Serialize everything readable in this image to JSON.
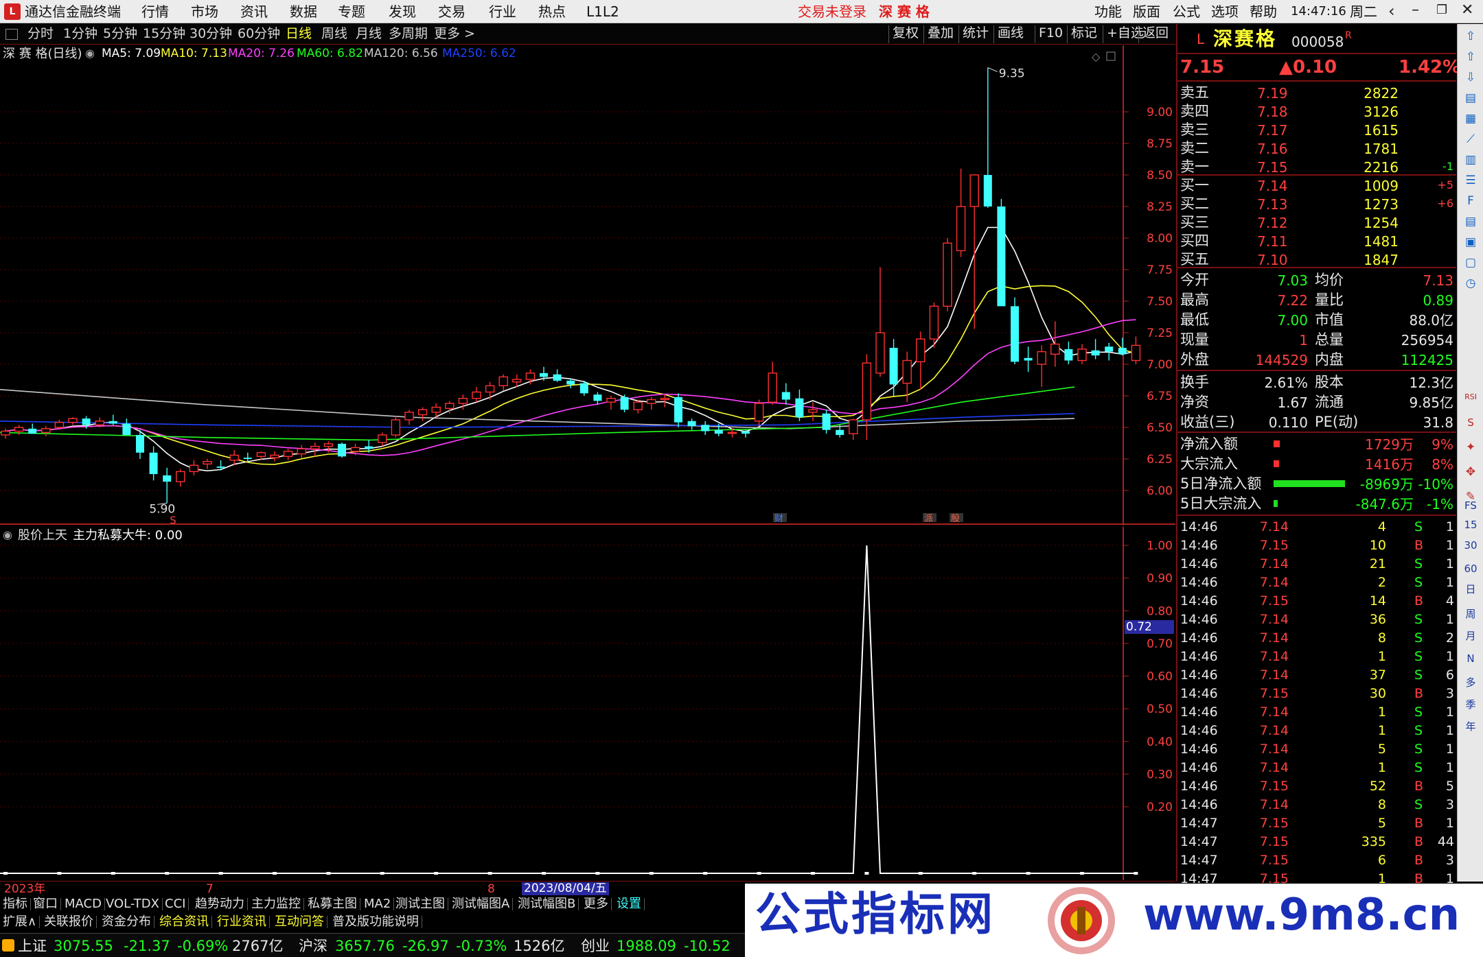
{
  "titlebar": {
    "app_title": "通达信金融终端",
    "menus": [
      "行情",
      "市场",
      "资讯",
      "数据",
      "专题",
      "发现",
      "交易",
      "行业",
      "热点",
      "L1L2"
    ],
    "login_status": "交易未登录",
    "stock_name_center": "深 赛 格",
    "right_menus": [
      "功能",
      "版面",
      "公式",
      "选项",
      "帮助"
    ],
    "clock": "14:47:16",
    "weekday": "周二"
  },
  "period_toolbar": {
    "tabs": [
      "分时",
      "1分钟",
      "5分钟",
      "15分钟",
      "30分钟",
      "60分钟",
      "日线",
      "周线",
      "月线",
      "多周期",
      "更多 >"
    ],
    "active": "日线",
    "right_tools": [
      "复权",
      "叠加",
      "统计",
      "画线",
      "F10",
      "标记",
      "+自选",
      "返回"
    ]
  },
  "main_chart": {
    "legend_title": "深 赛 格(日线)",
    "ma": [
      {
        "label": "MA5: 7.09",
        "color": "#ffffff"
      },
      {
        "label": "MA10: 7.13",
        "color": "#ffff33"
      },
      {
        "label": "MA20: 7.26",
        "color": "#ff40ff"
      },
      {
        "label": "MA60: 6.82",
        "color": "#20ff20"
      },
      {
        "label": "MA120: 6.56",
        "color": "#c8c8c8"
      },
      {
        "label": "MA250: 6.62",
        "color": "#2040ff"
      }
    ],
    "high_marker": "9.35",
    "low_marker": "5.90",
    "price_ticks": [
      "9.00",
      "8.75",
      "8.50",
      "8.25",
      "8.00",
      "7.75",
      "7.50",
      "7.25",
      "7.00",
      "6.75",
      "6.50",
      "6.25",
      "6.00"
    ],
    "event_labels": [
      "财",
      "派",
      "股"
    ],
    "low_mark_label": "S"
  },
  "indicator": {
    "title": "股价上天",
    "label": "主力私募大牛: 0.00",
    "ticks": [
      "1.00",
      "0.90",
      "0.80",
      "0.70",
      "0.60",
      "0.50",
      "0.40",
      "0.30",
      "0.20"
    ],
    "cursor_value": "0.72"
  },
  "datebar": {
    "year": "2023年",
    "m1": "7",
    "m2": "8",
    "highlight": "2023/08/04/五"
  },
  "tabs_row1": [
    "指标",
    "窗口",
    "MACD",
    "VOL-TDX",
    "CCI",
    "趋势动力",
    "主力监控",
    "私募主图",
    "MA2",
    "测试主图",
    "测试幅图A",
    "测试幅图B",
    "更多",
    "设置"
  ],
  "tabs_row2": [
    "扩展∧",
    "关联报价",
    "资金分布",
    "综合资讯",
    "行业资讯",
    "互动问答",
    "普及版功能说明"
  ],
  "statusbar": {
    "idx1_name": "上证",
    "idx1_val": "3075.55",
    "idx1_chg": "-21.37",
    "idx1_pct": "-0.69%",
    "idx1_amt": "2767亿",
    "idx2_name": "沪深",
    "idx2_val": "3657.76",
    "idx2_chg": "-26.97",
    "idx2_pct": "-0.73%",
    "idx2_amt": "1526亿",
    "idx3_name": "创业",
    "idx3_val": "1988.09",
    "idx3_chg": "-10.52"
  },
  "quote": {
    "l_badge": "L",
    "name": "深赛格",
    "code": "000058",
    "r_badge": "R",
    "price": "7.15",
    "change": "▲0.10",
    "pct": "1.42%",
    "asks": [
      {
        "label": "卖五",
        "price": "7.19",
        "vol": "2822",
        "delta": ""
      },
      {
        "label": "卖四",
        "price": "7.18",
        "vol": "3126",
        "delta": ""
      },
      {
        "label": "卖三",
        "price": "7.17",
        "vol": "1615",
        "delta": ""
      },
      {
        "label": "卖二",
        "price": "7.16",
        "vol": "1781",
        "delta": ""
      },
      {
        "label": "卖一",
        "price": "7.15",
        "vol": "2216",
        "delta": "-1"
      }
    ],
    "bids": [
      {
        "label": "买一",
        "price": "7.14",
        "vol": "1009",
        "delta": "+5"
      },
      {
        "label": "买二",
        "price": "7.13",
        "vol": "1273",
        "delta": "+6"
      },
      {
        "label": "买三",
        "price": "7.12",
        "vol": "1254",
        "delta": ""
      },
      {
        "label": "买四",
        "price": "7.11",
        "vol": "1481",
        "delta": ""
      },
      {
        "label": "买五",
        "price": "7.10",
        "vol": "1847",
        "delta": ""
      }
    ],
    "stats": [
      {
        "l1": "今开",
        "v1": "7.03",
        "l2": "均价",
        "v2": "7.13"
      },
      {
        "l1": "最高",
        "v1": "7.22",
        "l2": "量比",
        "v2": "0.89"
      },
      {
        "l1": "最低",
        "v1": "7.00",
        "l2": "市值",
        "v2": "88.0亿"
      },
      {
        "l1": "现量",
        "v1": "1",
        "l2": "总量",
        "v2": "256954"
      },
      {
        "l1": "外盘",
        "v1": "144529",
        "l2": "内盘",
        "v2": "112425"
      }
    ],
    "stats2": [
      {
        "l1": "换手",
        "v1": "2.61%",
        "l2": "股本",
        "v2": "12.3亿"
      },
      {
        "l1": "净资",
        "v1": "1.67",
        "l2": "流通",
        "v2": "9.85亿"
      },
      {
        "l1": "收益(三)",
        "v1": "0.110",
        "l2": "PE(动)",
        "v2": "31.8"
      }
    ],
    "flows": [
      {
        "label": "净流入额",
        "val": "1729万",
        "pct": "9%",
        "share": 0.09,
        "dir": "in"
      },
      {
        "label": "大宗流入",
        "val": "1416万",
        "pct": "8%",
        "share": 0.08,
        "dir": "in"
      },
      {
        "label": "5日净流入额",
        "val": "-8969万",
        "pct": "-10%",
        "share": 1.0,
        "dir": "out"
      },
      {
        "label": "5日大宗流入",
        "val": "-847.6万",
        "pct": "-1%",
        "share": 0.06,
        "dir": "out"
      }
    ],
    "ticks": [
      [
        "14:46",
        "7.14",
        "4",
        "S",
        "1"
      ],
      [
        "14:46",
        "7.15",
        "10",
        "B",
        "1"
      ],
      [
        "14:46",
        "7.14",
        "21",
        "S",
        "1"
      ],
      [
        "14:46",
        "7.14",
        "2",
        "S",
        "1"
      ],
      [
        "14:46",
        "7.15",
        "14",
        "B",
        "4"
      ],
      [
        "14:46",
        "7.14",
        "36",
        "S",
        "1"
      ],
      [
        "14:46",
        "7.14",
        "8",
        "S",
        "2"
      ],
      [
        "14:46",
        "7.14",
        "1",
        "S",
        "1"
      ],
      [
        "14:46",
        "7.14",
        "37",
        "S",
        "6"
      ],
      [
        "14:46",
        "7.15",
        "30",
        "B",
        "3"
      ],
      [
        "14:46",
        "7.14",
        "1",
        "S",
        "1"
      ],
      [
        "14:46",
        "7.14",
        "1",
        "S",
        "1"
      ],
      [
        "14:46",
        "7.14",
        "5",
        "S",
        "1"
      ],
      [
        "14:46",
        "7.14",
        "1",
        "S",
        "1"
      ],
      [
        "14:46",
        "7.15",
        "52",
        "B",
        "5"
      ],
      [
        "14:46",
        "7.14",
        "8",
        "S",
        "3"
      ],
      [
        "14:47",
        "7.15",
        "5",
        "B",
        "1"
      ],
      [
        "14:47",
        "7.15",
        "335",
        "B",
        "44"
      ],
      [
        "14:47",
        "7.15",
        "6",
        "B",
        "3"
      ],
      [
        "14:47",
        "7.15",
        "1",
        "B",
        "1"
      ]
    ]
  },
  "iconbar": {
    "labels": [
      "RSI",
      "S",
      "FS",
      "15",
      "30",
      "60",
      "日",
      "周",
      "月",
      "N",
      "多",
      "季",
      "年"
    ]
  },
  "watermark": {
    "left_text": "公式指标网",
    "right_text": "www.9m8.cn"
  },
  "chart_data": {
    "type": "candlestick",
    "ohlc": [
      [
        6.44,
        6.49,
        6.41,
        6.47
      ],
      [
        6.47,
        6.52,
        6.44,
        6.5
      ],
      [
        6.49,
        6.53,
        6.46,
        6.45
      ],
      [
        6.46,
        6.51,
        6.43,
        6.49
      ],
      [
        6.5,
        6.56,
        6.48,
        6.54
      ],
      [
        6.54,
        6.58,
        6.52,
        6.57
      ],
      [
        6.57,
        6.59,
        6.49,
        6.52
      ],
      [
        6.52,
        6.58,
        6.5,
        6.55
      ],
      [
        6.55,
        6.6,
        6.52,
        6.53
      ],
      [
        6.53,
        6.57,
        6.46,
        6.44
      ],
      [
        6.44,
        6.48,
        6.25,
        6.3
      ],
      [
        6.3,
        6.35,
        6.08,
        6.13
      ],
      [
        6.12,
        6.18,
        5.9,
        6.07
      ],
      [
        6.07,
        6.17,
        6.03,
        6.15
      ],
      [
        6.15,
        6.24,
        6.12,
        6.2
      ],
      [
        6.21,
        6.25,
        6.17,
        6.23
      ],
      [
        6.19,
        6.24,
        6.16,
        6.18
      ],
      [
        6.24,
        6.32,
        6.2,
        6.28
      ],
      [
        6.26,
        6.3,
        6.22,
        6.25
      ],
      [
        6.27,
        6.31,
        6.24,
        6.3
      ],
      [
        6.26,
        6.31,
        6.23,
        6.28
      ],
      [
        6.27,
        6.33,
        6.24,
        6.31
      ],
      [
        6.29,
        6.36,
        6.26,
        6.33
      ],
      [
        6.33,
        6.38,
        6.27,
        6.35
      ],
      [
        6.35,
        6.39,
        6.3,
        6.37
      ],
      [
        6.37,
        6.38,
        6.26,
        6.27
      ],
      [
        6.31,
        6.37,
        6.28,
        6.34
      ],
      [
        6.35,
        6.4,
        6.3,
        6.33
      ],
      [
        6.38,
        6.46,
        6.35,
        6.44
      ],
      [
        6.44,
        6.59,
        6.42,
        6.56
      ],
      [
        6.56,
        6.64,
        6.52,
        6.62
      ],
      [
        6.6,
        6.66,
        6.55,
        6.64
      ],
      [
        6.62,
        6.69,
        6.58,
        6.66
      ],
      [
        6.65,
        6.71,
        6.61,
        6.69
      ],
      [
        6.69,
        6.76,
        6.64,
        6.73
      ],
      [
        6.73,
        6.82,
        6.7,
        6.78
      ],
      [
        6.78,
        6.86,
        6.72,
        6.83
      ],
      [
        6.83,
        6.92,
        6.79,
        6.9
      ],
      [
        6.86,
        6.92,
        6.82,
        6.88
      ],
      [
        6.88,
        6.96,
        6.84,
        6.93
      ],
      [
        6.93,
        6.98,
        6.87,
        6.9
      ],
      [
        6.92,
        6.96,
        6.86,
        6.87
      ],
      [
        6.87,
        6.89,
        6.81,
        6.84
      ],
      [
        6.85,
        6.87,
        6.75,
        6.77
      ],
      [
        6.76,
        6.78,
        6.68,
        6.71
      ],
      [
        6.7,
        6.75,
        6.64,
        6.73
      ],
      [
        6.74,
        6.76,
        6.62,
        6.64
      ],
      [
        6.64,
        6.72,
        6.61,
        6.7
      ],
      [
        6.69,
        6.74,
        6.64,
        6.72
      ],
      [
        6.72,
        6.76,
        6.66,
        6.73
      ],
      [
        6.74,
        6.77,
        6.5,
        6.54
      ],
      [
        6.55,
        6.57,
        6.48,
        6.51
      ],
      [
        6.52,
        6.55,
        6.44,
        6.47
      ],
      [
        6.48,
        6.53,
        6.43,
        6.45
      ],
      [
        6.46,
        6.49,
        6.42,
        6.46
      ],
      [
        6.47,
        6.48,
        6.42,
        6.45
      ],
      [
        6.55,
        6.72,
        6.51,
        6.69
      ],
      [
        6.7,
        7.02,
        6.68,
        6.93
      ],
      [
        6.78,
        6.85,
        6.68,
        6.72
      ],
      [
        6.73,
        6.8,
        6.55,
        6.58
      ],
      [
        6.62,
        6.7,
        6.55,
        6.64
      ],
      [
        6.61,
        6.64,
        6.45,
        6.48
      ],
      [
        6.48,
        6.52,
        6.42,
        6.44
      ],
      [
        6.45,
        6.57,
        6.4,
        6.56
      ],
      [
        6.56,
        7.08,
        6.4,
        7.01
      ],
      [
        6.93,
        7.77,
        6.9,
        7.25
      ],
      [
        7.13,
        7.2,
        6.75,
        6.84
      ],
      [
        6.85,
        7.1,
        6.7,
        7.03
      ],
      [
        7.02,
        7.26,
        6.8,
        7.2
      ],
      [
        7.2,
        7.49,
        7.13,
        7.46
      ],
      [
        7.46,
        8.0,
        7.42,
        7.96
      ],
      [
        7.9,
        8.55,
        7.85,
        8.25
      ],
      [
        8.25,
        8.5,
        7.28,
        8.5
      ],
      [
        8.5,
        9.35,
        8.24,
        8.25
      ],
      [
        8.25,
        8.31,
        7.48,
        7.46
      ],
      [
        7.46,
        7.53,
        7.0,
        7.02
      ],
      [
        7.05,
        7.14,
        6.94,
        7.03
      ],
      [
        7.0,
        7.15,
        6.82,
        7.1
      ],
      [
        7.08,
        7.34,
        6.98,
        7.16
      ],
      [
        7.12,
        7.18,
        7.0,
        7.03
      ],
      [
        7.03,
        7.16,
        7.0,
        7.12
      ],
      [
        7.11,
        7.2,
        7.04,
        7.07
      ],
      [
        7.14,
        7.17,
        7.03,
        7.1
      ],
      [
        7.13,
        7.21,
        7.07,
        7.08
      ],
      [
        7.03,
        7.22,
        7.0,
        7.15
      ]
    ],
    "indicator": {
      "name": "主力私募大牛",
      "peak_value": 1.0,
      "peak_index": 64
    },
    "ylim": [
      5.8,
      9.5
    ]
  }
}
